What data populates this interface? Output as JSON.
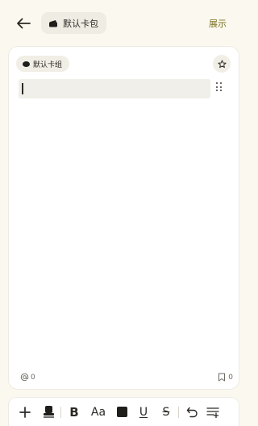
{
  "header": {
    "back_icon": "arrow-left-icon",
    "pack_label": "默认卡包",
    "pack_icon": "card-pack-icon",
    "show_label": "展示"
  },
  "card": {
    "group_label": "默认卡组",
    "star_icon": "star-icon",
    "editor_value": "",
    "mentions_count": "0",
    "bookmarks_count": "0"
  },
  "toolbar": {
    "items": [
      "plus-icon",
      "stamp-icon",
      "bold-icon",
      "font-size-icon",
      "color-icon",
      "underline-icon",
      "strikethrough-icon",
      "undo-icon",
      "list-add-icon"
    ],
    "bold_label": "B",
    "font_label": "Aa",
    "underline_label": "U",
    "strike_label": "S"
  },
  "colors": {
    "background": "#fbf8ef",
    "accent_text": "#7a7020",
    "card": "#ffffff"
  }
}
